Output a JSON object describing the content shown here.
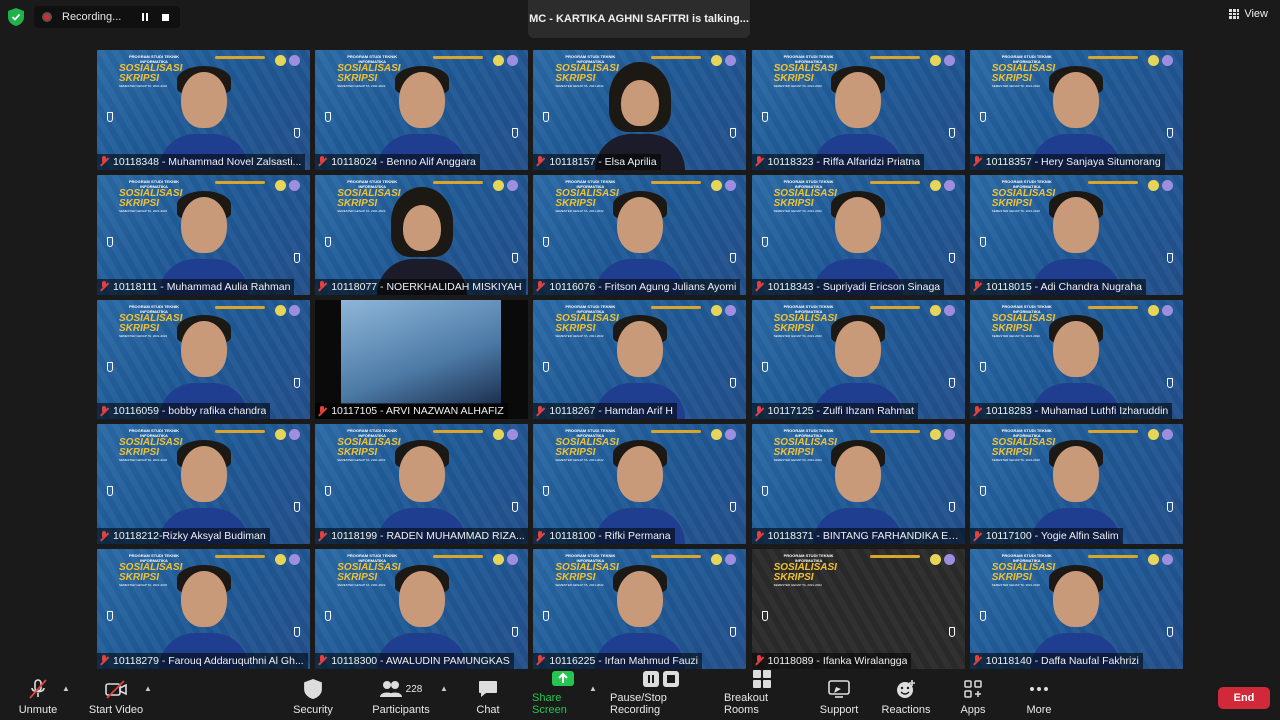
{
  "top": {
    "recording_label": "Recording...",
    "talking_text": "MC - KARTIKA AGHNI SAFITRI is talking...",
    "view_label": "View"
  },
  "tile_banner": {
    "line1": "PROGRAM STUDI TEKNIK INFORMATIKA",
    "line2": "SOSIALISASI SKRIPSI",
    "line3": "SEMESTER GENAP TA. 2021-2022"
  },
  "participants_tiles": [
    {
      "name": "10118348 - Muhammad Novel Zalsasti..."
    },
    {
      "name": "10118024 - Benno Alif Anggara"
    },
    {
      "name": "10118157 - Elsa Aprilia"
    },
    {
      "name": "10118323 - Riffa Alfaridzi Priatna"
    },
    {
      "name": "10118357 - Hery Sanjaya Situmorang"
    },
    {
      "name": "10118111 - Muhammad Aulia Rahman"
    },
    {
      "name": "10118077 - NOERKHALIDAH MISKIYAH"
    },
    {
      "name": "10116076 - Fritson Agung Julians Ayomi"
    },
    {
      "name": "10118343 - Supriyadi Ericson Sinaga"
    },
    {
      "name": "10118015 - Adi Chandra Nugraha"
    },
    {
      "name": "10116059 - bobby rafika chandra"
    },
    {
      "name": "10117105 - ARVI NAZWAN ALHAFIZ"
    },
    {
      "name": "10118267 - Hamdan Arif H"
    },
    {
      "name": "10117125 - Zulfi Ihzam Rahmat"
    },
    {
      "name": "10118283 - Muhamad Luthfi Izharuddin"
    },
    {
      "name": "10118212-Rizky Aksyal Budiman"
    },
    {
      "name": "10118199 - RADEN MUHAMMAD RIZA..."
    },
    {
      "name": "10118100 - Rifki Permana"
    },
    {
      "name": "10118371 - BINTANG FARHANDIKA EDI..."
    },
    {
      "name": "10117100 - Yogie Alfin Salim"
    },
    {
      "name": "10118279 - Farouq Addaruquthni Al Gh..."
    },
    {
      "name": "10118300 - AWALUDIN PAMUNGKAS"
    },
    {
      "name": "10116225 - Irfan Mahmud Fauzi"
    },
    {
      "name": "10118089 - Ifanka Wiralangga"
    },
    {
      "name": "10118140 - Daffa Naufal Fakhrizi"
    }
  ],
  "toolbar": {
    "unmute": "Unmute",
    "start_video": "Start Video",
    "security": "Security",
    "participants": "Participants",
    "participants_count": "228",
    "chat": "Chat",
    "share_screen": "Share Screen",
    "pause_stop": "Pause/Stop Recording",
    "breakout": "Breakout Rooms",
    "support": "Support",
    "reactions": "Reactions",
    "apps": "Apps",
    "more": "More",
    "end": "End"
  },
  "colors": {
    "accent_green": "#26c551",
    "end_red": "#d1283a",
    "mic_muted_red": "#e34040"
  }
}
